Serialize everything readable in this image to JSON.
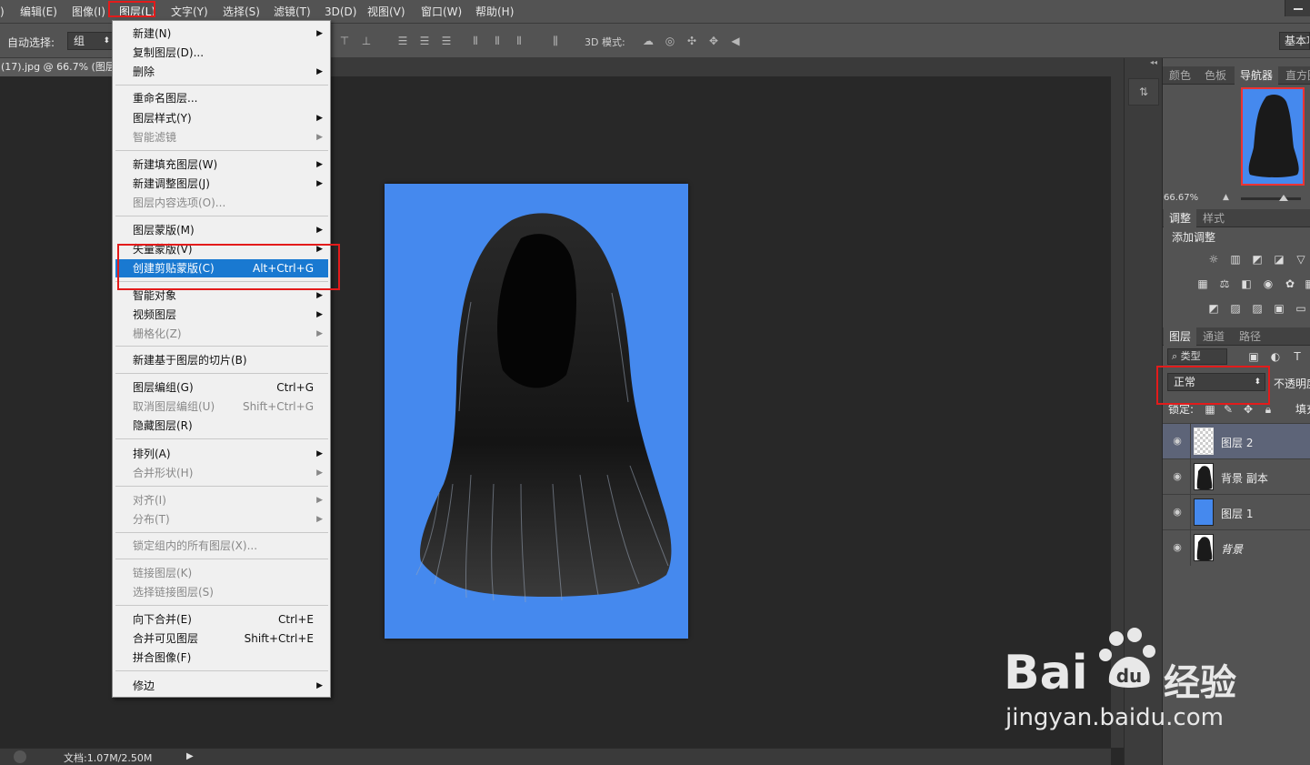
{
  "menubar": {
    "items": [
      {
        "label": "ﾞ)"
      },
      {
        "label": "编辑(E)"
      },
      {
        "label": "图像(I)"
      },
      {
        "label": "图层(L)"
      },
      {
        "label": "文字(Y)"
      },
      {
        "label": "选择(S)"
      },
      {
        "label": "滤镜(T)"
      },
      {
        "label": "3D(D)"
      },
      {
        "label": "视图(V)"
      },
      {
        "label": "窗口(W)"
      },
      {
        "label": "帮助(H)"
      }
    ]
  },
  "options_bar": {
    "auto_select_label": "自动选择:",
    "auto_select_value": "组",
    "mode_3d_label": "3D 模式:",
    "workspace": "基本功能"
  },
  "document": {
    "tab_title": "(17).jpg @ 66.7% (图层",
    "status": "文档:1.07M/2.50M"
  },
  "layer_menu": {
    "items": [
      {
        "label": "新建(N)",
        "shortcut": "",
        "submenu": true,
        "disabled": false
      },
      {
        "label": "复制图层(D)...",
        "shortcut": "",
        "submenu": false,
        "disabled": false
      },
      {
        "label": "删除",
        "shortcut": "",
        "submenu": true,
        "disabled": false
      },
      {
        "label": "重命名图层...",
        "shortcut": "",
        "submenu": false,
        "disabled": false
      },
      {
        "label": "图层样式(Y)",
        "shortcut": "",
        "submenu": true,
        "disabled": false
      },
      {
        "label": "智能滤镜",
        "shortcut": "",
        "submenu": true,
        "disabled": true
      },
      {
        "label": "新建填充图层(W)",
        "shortcut": "",
        "submenu": true,
        "disabled": false
      },
      {
        "label": "新建调整图层(J)",
        "shortcut": "",
        "submenu": true,
        "disabled": false
      },
      {
        "label": "图层内容选项(O)...",
        "shortcut": "",
        "submenu": false,
        "disabled": true
      },
      {
        "label": "图层蒙版(M)",
        "shortcut": "",
        "submenu": true,
        "disabled": false
      },
      {
        "label": "矢量蒙版(V)",
        "shortcut": "",
        "submenu": true,
        "disabled": false
      },
      {
        "label": "创建剪贴蒙版(C)",
        "shortcut": "Alt+Ctrl+G",
        "submenu": false,
        "disabled": false
      },
      {
        "label": "智能对象",
        "shortcut": "",
        "submenu": true,
        "disabled": false
      },
      {
        "label": "视频图层",
        "shortcut": "",
        "submenu": true,
        "disabled": false
      },
      {
        "label": "栅格化(Z)",
        "shortcut": "",
        "submenu": true,
        "disabled": true
      },
      {
        "label": "新建基于图层的切片(B)",
        "shortcut": "",
        "submenu": false,
        "disabled": false
      },
      {
        "label": "图层编组(G)",
        "shortcut": "Ctrl+G",
        "submenu": false,
        "disabled": false
      },
      {
        "label": "取消图层编组(U)",
        "shortcut": "Shift+Ctrl+G",
        "submenu": false,
        "disabled": true
      },
      {
        "label": "隐藏图层(R)",
        "shortcut": "",
        "submenu": false,
        "disabled": false
      },
      {
        "label": "排列(A)",
        "shortcut": "",
        "submenu": true,
        "disabled": false
      },
      {
        "label": "合并形状(H)",
        "shortcut": "",
        "submenu": true,
        "disabled": true
      },
      {
        "label": "对齐(I)",
        "shortcut": "",
        "submenu": true,
        "disabled": true
      },
      {
        "label": "分布(T)",
        "shortcut": "",
        "submenu": true,
        "disabled": true
      },
      {
        "label": "锁定组内的所有图层(X)...",
        "shortcut": "",
        "submenu": false,
        "disabled": true
      },
      {
        "label": "链接图层(K)",
        "shortcut": "",
        "submenu": false,
        "disabled": true
      },
      {
        "label": "选择链接图层(S)",
        "shortcut": "",
        "submenu": false,
        "disabled": true
      },
      {
        "label": "向下合并(E)",
        "shortcut": "Ctrl+E",
        "submenu": false,
        "disabled": false
      },
      {
        "label": "合并可见图层",
        "shortcut": "Shift+Ctrl+E",
        "submenu": false,
        "disabled": false
      },
      {
        "label": "拼合图像(F)",
        "shortcut": "",
        "submenu": false,
        "disabled": false
      },
      {
        "label": "修边",
        "shortcut": "",
        "submenu": true,
        "disabled": false
      }
    ]
  },
  "right_panel": {
    "top_tabs": [
      "颜色",
      "色板",
      "导航器",
      "直方图"
    ],
    "zoom": "66.67%",
    "adjust_tabs": [
      "调整",
      "样式"
    ],
    "adjust_title": "添加调整",
    "layer_tabs": [
      "图层",
      "通道",
      "路径"
    ],
    "filter_kind": "类型",
    "blend_mode": "正常",
    "opacity_label": "不透明度:",
    "lock_label": "锁定:",
    "fill_label": "填充:",
    "layers": [
      {
        "name": "图层 2",
        "selected": true
      },
      {
        "name": "背景 副本",
        "selected": false
      },
      {
        "name": "图层 1",
        "selected": false
      },
      {
        "name": "背景",
        "selected": false
      }
    ]
  },
  "watermark": {
    "brand": "Bai",
    "brand2": "经验",
    "url": "jingyan.baidu.com"
  },
  "colors": {
    "canvas_blue": "#4589ee",
    "highlight": "#1979d1",
    "annotation_red": "#e31b1b"
  }
}
